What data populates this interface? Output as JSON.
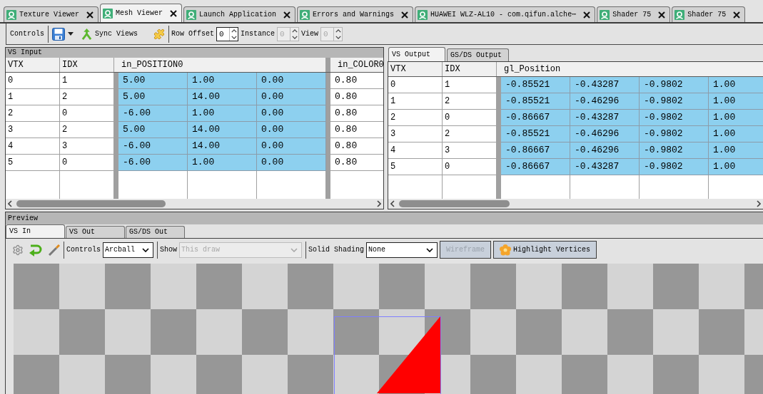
{
  "document_tabs": [
    {
      "label": "Texture Viewer",
      "selected": false
    },
    {
      "label": "Mesh Viewer",
      "selected": true
    },
    {
      "label": "Launch Application",
      "selected": false
    },
    {
      "label": "Errors and Warnings",
      "selected": false
    },
    {
      "label": "HUAWEI WLZ-AL10 - com.qifun.alche⋯",
      "selected": false
    },
    {
      "label": "Shader 75",
      "selected": false
    },
    {
      "label": "Shader 75",
      "selected": false
    }
  ],
  "toolbar": {
    "label": "Controls",
    "sync_button": "Sync Views",
    "spinboxes": [
      {
        "label": "Row Offset",
        "value": "0",
        "disabled": false
      },
      {
        "label": "Instance",
        "value": "0",
        "disabled": true
      },
      {
        "label": "View",
        "value": "0",
        "disabled": true
      }
    ]
  },
  "vs_input": {
    "title": "VS Input",
    "index_columns": [
      "VTX",
      "IDX"
    ],
    "attributes": [
      {
        "name": "in_POSITION0",
        "highlighted": true
      },
      {
        "name": "in_COLOR0",
        "highlighted": false
      }
    ],
    "rows": [
      {
        "vtx": "0",
        "idx": "1",
        "values": [
          [
            "5.00",
            "1.00",
            "0.00"
          ],
          [
            "0.80"
          ]
        ]
      },
      {
        "vtx": "1",
        "idx": "2",
        "values": [
          [
            "5.00",
            "14.00",
            "0.00"
          ],
          [
            "0.80"
          ]
        ]
      },
      {
        "vtx": "2",
        "idx": "0",
        "values": [
          [
            "-6.00",
            "1.00",
            "0.00"
          ],
          [
            "0.80"
          ]
        ]
      },
      {
        "vtx": "3",
        "idx": "2",
        "values": [
          [
            "5.00",
            "14.00",
            "0.00"
          ],
          [
            "0.80"
          ]
        ]
      },
      {
        "vtx": "4",
        "idx": "3",
        "values": [
          [
            "-6.00",
            "14.00",
            "0.00"
          ],
          [
            "0.80"
          ]
        ]
      },
      {
        "vtx": "5",
        "idx": "0",
        "values": [
          [
            "-6.00",
            "1.00",
            "0.00"
          ],
          [
            "0.80"
          ]
        ]
      }
    ]
  },
  "vs_output": {
    "tabs": [
      {
        "label": "VS Output",
        "selected": true
      },
      {
        "label": "GS/DS Output",
        "selected": false
      }
    ],
    "index_columns": [
      "VTX",
      "IDX"
    ],
    "attributes": [
      {
        "name": "gl_Position",
        "highlighted": true
      }
    ],
    "rows": [
      {
        "vtx": "0",
        "idx": "1",
        "values": [
          [
            "-0.85521",
            "-0.43287",
            "-0.9802",
            "1.00"
          ]
        ]
      },
      {
        "vtx": "1",
        "idx": "2",
        "values": [
          [
            "-0.85521",
            "-0.46296",
            "-0.9802",
            "1.00"
          ]
        ]
      },
      {
        "vtx": "2",
        "idx": "0",
        "values": [
          [
            "-0.86667",
            "-0.43287",
            "-0.9802",
            "1.00"
          ]
        ]
      },
      {
        "vtx": "3",
        "idx": "2",
        "values": [
          [
            "-0.85521",
            "-0.46296",
            "-0.9802",
            "1.00"
          ]
        ]
      },
      {
        "vtx": "4",
        "idx": "3",
        "values": [
          [
            "-0.86667",
            "-0.46296",
            "-0.9802",
            "1.00"
          ]
        ]
      },
      {
        "vtx": "5",
        "idx": "0",
        "values": [
          [
            "-0.86667",
            "-0.43287",
            "-0.9802",
            "1.00"
          ]
        ]
      }
    ]
  },
  "preview": {
    "title": "Preview",
    "tabs": [
      {
        "label": "VS In",
        "selected": true
      },
      {
        "label": "VS Out",
        "selected": false
      },
      {
        "label": "GS/DS Out",
        "selected": false
      }
    ],
    "toolbar": {
      "dropdowns": [
        {
          "label": "Controls",
          "value": "Arcball",
          "disabled": false
        },
        {
          "label": "Show",
          "value": "This draw",
          "disabled": true
        },
        {
          "label": "Solid Shading",
          "value": "None",
          "disabled": false
        }
      ],
      "buttons": [
        {
          "kind": "text",
          "label": "Wireframe",
          "disabled": true
        },
        {
          "kind": "icon_text",
          "label": "Highlight Vertices",
          "disabled": false
        }
      ]
    }
  }
}
